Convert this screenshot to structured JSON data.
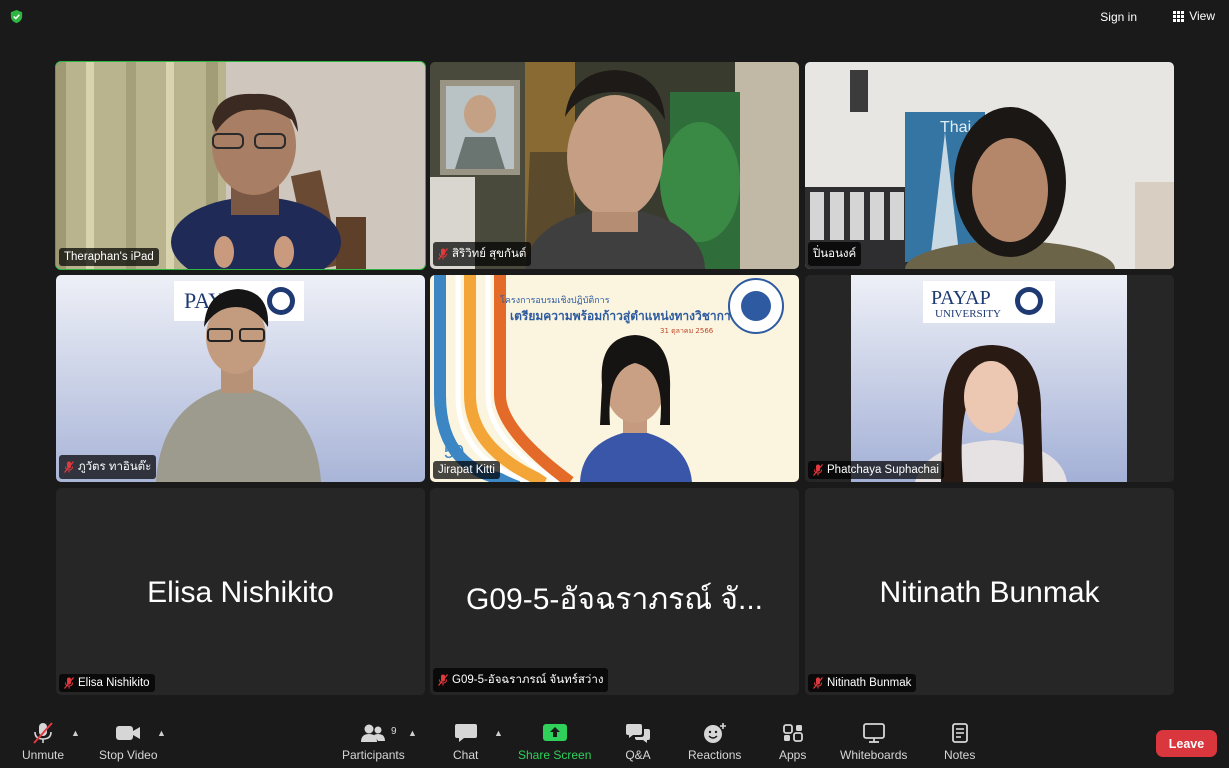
{
  "top_bar": {
    "sign_in": "Sign in",
    "view": "View"
  },
  "tiles": [
    {
      "name": "Theraphan's iPad",
      "muted": false,
      "active": true
    },
    {
      "name": "สิริวิทย์ สุขกันต์",
      "muted": true
    },
    {
      "name": "ปิ่นอนงค์",
      "muted": false
    },
    {
      "name": "ภูวัตร ทาอินต๊ะ",
      "muted": true
    },
    {
      "name": "Jirapat Kitti",
      "muted": false
    },
    {
      "name": "Phatchaya Suphachai",
      "muted": true
    },
    {
      "name": "Elisa Nishikito",
      "big": "Elisa Nishikito",
      "muted": true
    },
    {
      "name": "G09-5-อัจฉราภรณ์ จันทร์สว่าง",
      "big": "G09-5-อัจฉราภรณ์ จั...",
      "muted": true
    },
    {
      "name": "Nitinath Bunmak",
      "big": "Nitinath Bunmak",
      "muted": true
    }
  ],
  "backgrounds": {
    "payap_logo": "PAYAP",
    "payap_sub": "UNIVERSITY",
    "thai": "Thai",
    "slide_line1": "โครงการอบรมเชิงปฏิบัติการ",
    "slide_line2": "เตรียมความพร้อมก้าวสู่ตำแหน่งทางวิชาการ",
    "slide_date": "31 ตุลาคม 2566",
    "slide_50": "50"
  },
  "toolbar": {
    "unmute": "Unmute",
    "stop_video": "Stop Video",
    "participants": "Participants",
    "participants_count": "9",
    "chat": "Chat",
    "share_screen": "Share Screen",
    "qa": "Q&A",
    "reactions": "Reactions",
    "apps": "Apps",
    "whiteboards": "Whiteboards",
    "notes": "Notes",
    "leave": "Leave"
  },
  "colors": {
    "accent_green": "#2fb640",
    "leave_red": "#d9363e",
    "muted_red": "#e0393e"
  }
}
